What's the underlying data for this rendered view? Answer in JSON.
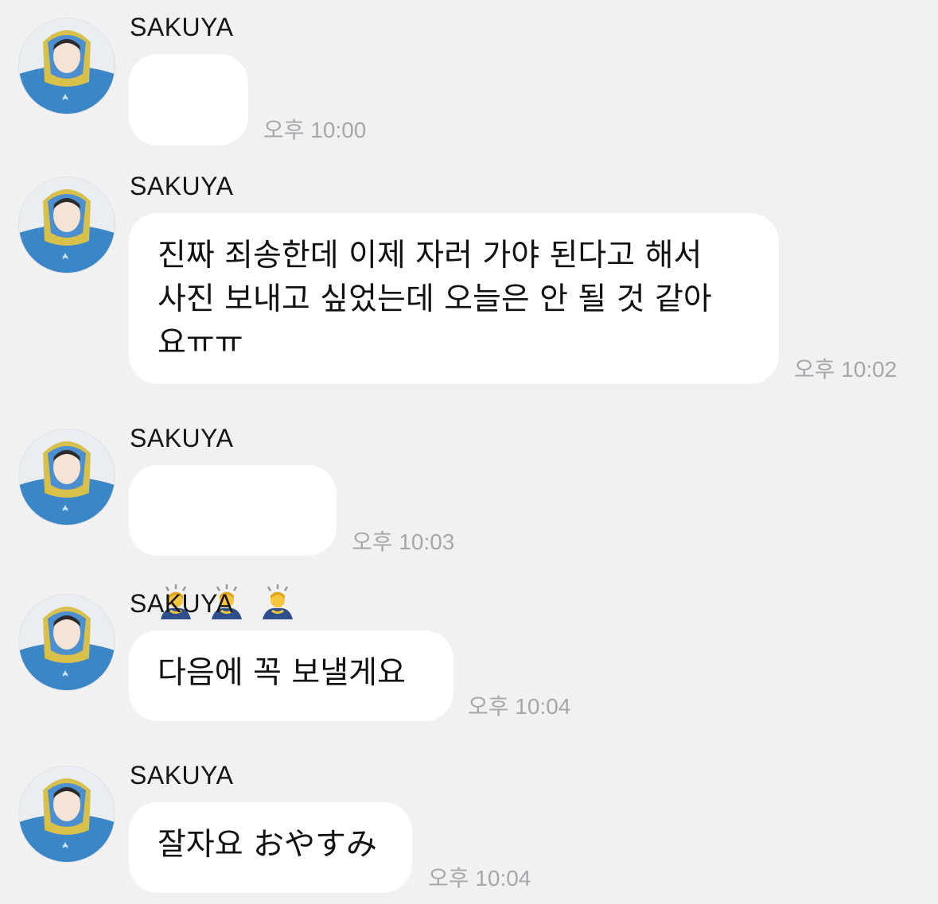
{
  "messages": [
    {
      "sender": "SAKUYA",
      "text": "",
      "time": "오후 10:00"
    },
    {
      "sender": "SAKUYA",
      "text": "진짜 죄송한데 이제 자러 가야 된다고 해서\n사진 보내고 싶었는데 오늘은 안 될 것 같아\n요ㅠㅠ",
      "time": "오후 10:02"
    },
    {
      "sender": "SAKUYA",
      "emoji": [
        "person-bowing",
        "person-bowing",
        "person-bowing"
      ],
      "time": "오후 10:03"
    },
    {
      "sender": "SAKUYA",
      "text": "다음에 꼭 보낼게요",
      "time": "오후 10:04"
    },
    {
      "sender": "SAKUYA",
      "text": "잘자요 おやすみ",
      "time": "오후 10:04"
    }
  ],
  "colors": {
    "background": "#f1f1f2",
    "bubble": "#ffffff",
    "timestamp": "#a7a7ab",
    "text": "#111111"
  }
}
